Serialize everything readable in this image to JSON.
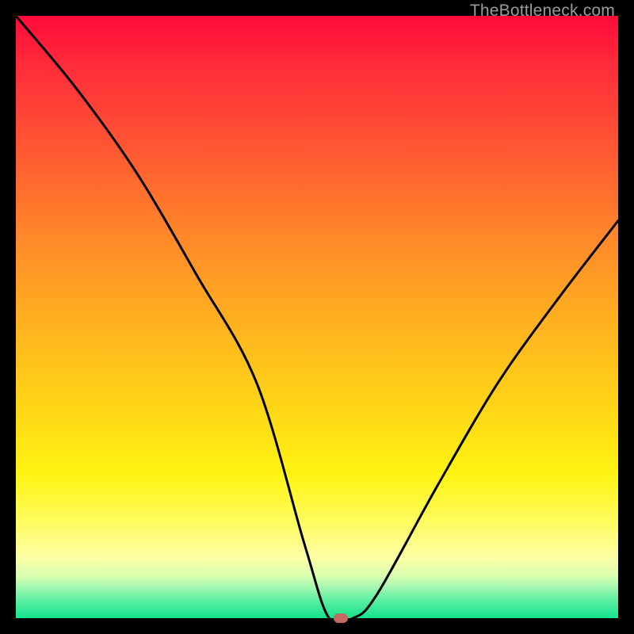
{
  "watermark": "TheBottleneck.com",
  "chart_data": {
    "type": "line",
    "title": "",
    "xlabel": "",
    "ylabel": "",
    "ylim": [
      0,
      100
    ],
    "xlim": [
      0,
      100
    ],
    "series": [
      {
        "name": "bottleneck-curve",
        "x": [
          0,
          10,
          20,
          30,
          40,
          48,
          52,
          56,
          60,
          70,
          80,
          90,
          100
        ],
        "values": [
          100,
          88,
          74,
          57,
          39,
          12,
          0,
          0,
          4,
          22,
          39,
          53,
          66
        ]
      }
    ],
    "marker": {
      "x": 54,
      "y": 0
    },
    "colors": {
      "curve": "#000000",
      "marker": "#c46a62",
      "gradient_top": "#ff0a3a",
      "gradient_bottom": "#14e38e"
    }
  }
}
